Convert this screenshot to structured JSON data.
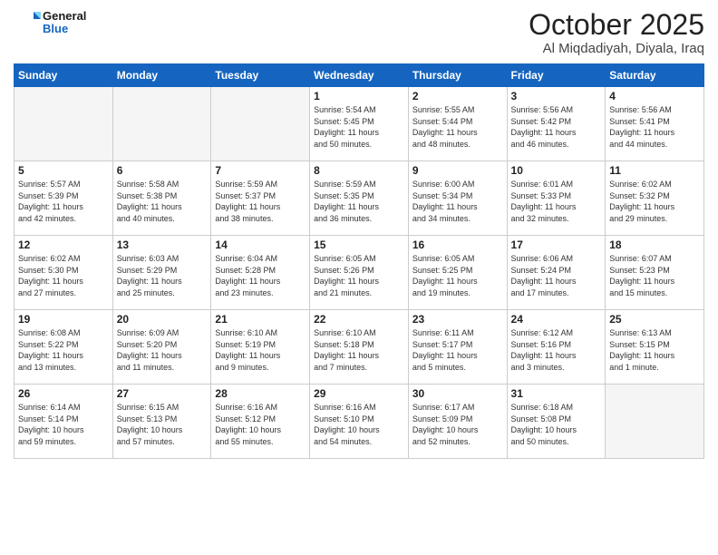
{
  "logo": {
    "line1": "General",
    "line2": "Blue"
  },
  "header": {
    "month": "October 2025",
    "location": "Al Miqdadiyah, Diyala, Iraq"
  },
  "weekdays": [
    "Sunday",
    "Monday",
    "Tuesday",
    "Wednesday",
    "Thursday",
    "Friday",
    "Saturday"
  ],
  "weeks": [
    [
      {
        "day": "",
        "info": ""
      },
      {
        "day": "",
        "info": ""
      },
      {
        "day": "",
        "info": ""
      },
      {
        "day": "1",
        "info": "Sunrise: 5:54 AM\nSunset: 5:45 PM\nDaylight: 11 hours\nand 50 minutes."
      },
      {
        "day": "2",
        "info": "Sunrise: 5:55 AM\nSunset: 5:44 PM\nDaylight: 11 hours\nand 48 minutes."
      },
      {
        "day": "3",
        "info": "Sunrise: 5:56 AM\nSunset: 5:42 PM\nDaylight: 11 hours\nand 46 minutes."
      },
      {
        "day": "4",
        "info": "Sunrise: 5:56 AM\nSunset: 5:41 PM\nDaylight: 11 hours\nand 44 minutes."
      }
    ],
    [
      {
        "day": "5",
        "info": "Sunrise: 5:57 AM\nSunset: 5:39 PM\nDaylight: 11 hours\nand 42 minutes."
      },
      {
        "day": "6",
        "info": "Sunrise: 5:58 AM\nSunset: 5:38 PM\nDaylight: 11 hours\nand 40 minutes."
      },
      {
        "day": "7",
        "info": "Sunrise: 5:59 AM\nSunset: 5:37 PM\nDaylight: 11 hours\nand 38 minutes."
      },
      {
        "day": "8",
        "info": "Sunrise: 5:59 AM\nSunset: 5:35 PM\nDaylight: 11 hours\nand 36 minutes."
      },
      {
        "day": "9",
        "info": "Sunrise: 6:00 AM\nSunset: 5:34 PM\nDaylight: 11 hours\nand 34 minutes."
      },
      {
        "day": "10",
        "info": "Sunrise: 6:01 AM\nSunset: 5:33 PM\nDaylight: 11 hours\nand 32 minutes."
      },
      {
        "day": "11",
        "info": "Sunrise: 6:02 AM\nSunset: 5:32 PM\nDaylight: 11 hours\nand 29 minutes."
      }
    ],
    [
      {
        "day": "12",
        "info": "Sunrise: 6:02 AM\nSunset: 5:30 PM\nDaylight: 11 hours\nand 27 minutes."
      },
      {
        "day": "13",
        "info": "Sunrise: 6:03 AM\nSunset: 5:29 PM\nDaylight: 11 hours\nand 25 minutes."
      },
      {
        "day": "14",
        "info": "Sunrise: 6:04 AM\nSunset: 5:28 PM\nDaylight: 11 hours\nand 23 minutes."
      },
      {
        "day": "15",
        "info": "Sunrise: 6:05 AM\nSunset: 5:26 PM\nDaylight: 11 hours\nand 21 minutes."
      },
      {
        "day": "16",
        "info": "Sunrise: 6:05 AM\nSunset: 5:25 PM\nDaylight: 11 hours\nand 19 minutes."
      },
      {
        "day": "17",
        "info": "Sunrise: 6:06 AM\nSunset: 5:24 PM\nDaylight: 11 hours\nand 17 minutes."
      },
      {
        "day": "18",
        "info": "Sunrise: 6:07 AM\nSunset: 5:23 PM\nDaylight: 11 hours\nand 15 minutes."
      }
    ],
    [
      {
        "day": "19",
        "info": "Sunrise: 6:08 AM\nSunset: 5:22 PM\nDaylight: 11 hours\nand 13 minutes."
      },
      {
        "day": "20",
        "info": "Sunrise: 6:09 AM\nSunset: 5:20 PM\nDaylight: 11 hours\nand 11 minutes."
      },
      {
        "day": "21",
        "info": "Sunrise: 6:10 AM\nSunset: 5:19 PM\nDaylight: 11 hours\nand 9 minutes."
      },
      {
        "day": "22",
        "info": "Sunrise: 6:10 AM\nSunset: 5:18 PM\nDaylight: 11 hours\nand 7 minutes."
      },
      {
        "day": "23",
        "info": "Sunrise: 6:11 AM\nSunset: 5:17 PM\nDaylight: 11 hours\nand 5 minutes."
      },
      {
        "day": "24",
        "info": "Sunrise: 6:12 AM\nSunset: 5:16 PM\nDaylight: 11 hours\nand 3 minutes."
      },
      {
        "day": "25",
        "info": "Sunrise: 6:13 AM\nSunset: 5:15 PM\nDaylight: 11 hours\nand 1 minute."
      }
    ],
    [
      {
        "day": "26",
        "info": "Sunrise: 6:14 AM\nSunset: 5:14 PM\nDaylight: 10 hours\nand 59 minutes."
      },
      {
        "day": "27",
        "info": "Sunrise: 6:15 AM\nSunset: 5:13 PM\nDaylight: 10 hours\nand 57 minutes."
      },
      {
        "day": "28",
        "info": "Sunrise: 6:16 AM\nSunset: 5:12 PM\nDaylight: 10 hours\nand 55 minutes."
      },
      {
        "day": "29",
        "info": "Sunrise: 6:16 AM\nSunset: 5:10 PM\nDaylight: 10 hours\nand 54 minutes."
      },
      {
        "day": "30",
        "info": "Sunrise: 6:17 AM\nSunset: 5:09 PM\nDaylight: 10 hours\nand 52 minutes."
      },
      {
        "day": "31",
        "info": "Sunrise: 6:18 AM\nSunset: 5:08 PM\nDaylight: 10 hours\nand 50 minutes."
      },
      {
        "day": "",
        "info": ""
      }
    ]
  ]
}
